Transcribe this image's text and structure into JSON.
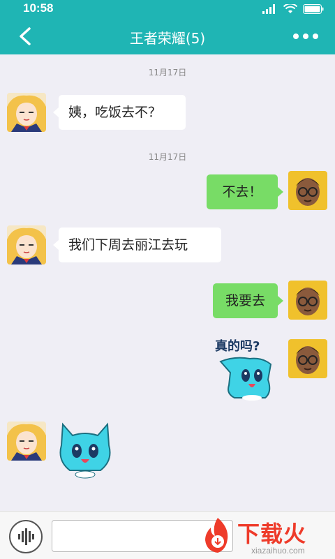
{
  "status": {
    "time": "10:58"
  },
  "header": {
    "title": "王者荣耀(5)"
  },
  "messages": {
    "ts1": "11月17日",
    "m1": "姨，吃饭去不？",
    "ts2": "11月17日",
    "m2": "不去！",
    "m3": "我们下周去丽江去玩",
    "m4": "我要去",
    "m5_sticker_text": "真的吗?"
  },
  "watermark": {
    "title": "下载火",
    "url": "xiazaihuo.com"
  },
  "colors": {
    "primary": "#1fb5b4",
    "bubble_self": "#78dc66",
    "bubble_other": "#ffffff",
    "background": "#efeef5",
    "watermark": "#ee3b2a"
  }
}
